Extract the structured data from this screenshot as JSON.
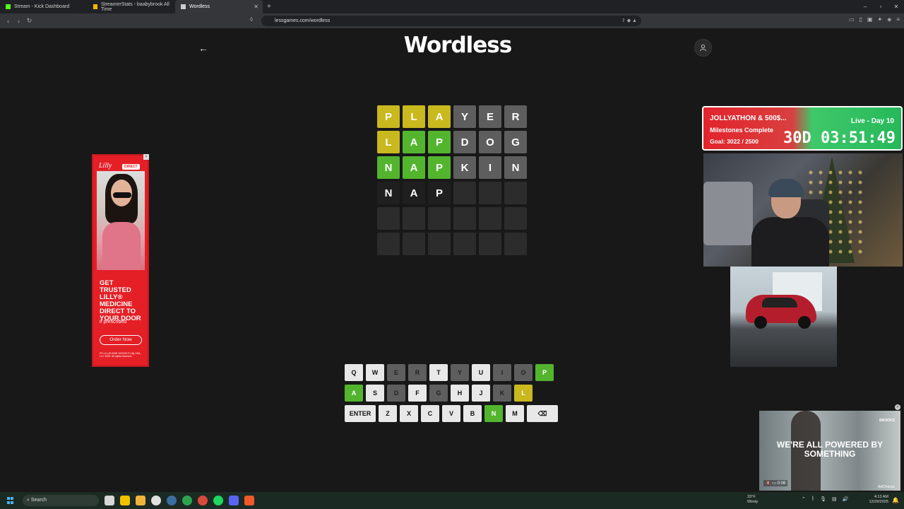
{
  "browser": {
    "tabs": [
      {
        "label": "Stream - Kick Dashboard",
        "favicon_color": "#53fc18"
      },
      {
        "label": "StreamerStats - baabybrook All Time",
        "favicon_color": "#f5b800"
      },
      {
        "label": "Wordless",
        "favicon_color": "#cccccc"
      }
    ],
    "url": "lessgames.com/wordless"
  },
  "page": {
    "title": "Wordless"
  },
  "grid": {
    "rows": [
      [
        {
          "l": "P",
          "s": "y"
        },
        {
          "l": "L",
          "s": "y"
        },
        {
          "l": "A",
          "s": "y"
        },
        {
          "l": "Y",
          "s": "x"
        },
        {
          "l": "E",
          "s": "x"
        },
        {
          "l": "R",
          "s": "x"
        }
      ],
      [
        {
          "l": "L",
          "s": "y"
        },
        {
          "l": "A",
          "s": "g"
        },
        {
          "l": "P",
          "s": "g"
        },
        {
          "l": "D",
          "s": "x"
        },
        {
          "l": "O",
          "s": "x"
        },
        {
          "l": "G",
          "s": "x"
        }
      ],
      [
        {
          "l": "N",
          "s": "g"
        },
        {
          "l": "A",
          "s": "g"
        },
        {
          "l": "P",
          "s": "g"
        },
        {
          "l": "K",
          "s": "x"
        },
        {
          "l": "I",
          "s": "x"
        },
        {
          "l": "N",
          "s": "x"
        }
      ],
      [
        {
          "l": "N",
          "s": "t"
        },
        {
          "l": "A",
          "s": "t"
        },
        {
          "l": "P",
          "s": "t"
        },
        {
          "l": "",
          "s": "e"
        },
        {
          "l": "",
          "s": "e"
        },
        {
          "l": "",
          "s": "e"
        }
      ],
      [
        {
          "l": "",
          "s": "e"
        },
        {
          "l": "",
          "s": "e"
        },
        {
          "l": "",
          "s": "e"
        },
        {
          "l": "",
          "s": "e"
        },
        {
          "l": "",
          "s": "e"
        },
        {
          "l": "",
          "s": "e"
        }
      ],
      [
        {
          "l": "",
          "s": "e"
        },
        {
          "l": "",
          "s": "e"
        },
        {
          "l": "",
          "s": "e"
        },
        {
          "l": "",
          "s": "e"
        },
        {
          "l": "",
          "s": "e"
        },
        {
          "l": "",
          "s": "e"
        }
      ]
    ]
  },
  "keyboard": {
    "rows": [
      [
        {
          "k": "Q",
          "s": ""
        },
        {
          "k": "W",
          "s": ""
        },
        {
          "k": "E",
          "s": "x"
        },
        {
          "k": "R",
          "s": "x"
        },
        {
          "k": "T",
          "s": ""
        },
        {
          "k": "Y",
          "s": "x"
        },
        {
          "k": "U",
          "s": ""
        },
        {
          "k": "I",
          "s": "x"
        },
        {
          "k": "O",
          "s": "x"
        },
        {
          "k": "P",
          "s": "g"
        }
      ],
      [
        {
          "k": "A",
          "s": "g"
        },
        {
          "k": "S",
          "s": ""
        },
        {
          "k": "D",
          "s": "x"
        },
        {
          "k": "F",
          "s": ""
        },
        {
          "k": "G",
          "s": "x"
        },
        {
          "k": "H",
          "s": ""
        },
        {
          "k": "J",
          "s": ""
        },
        {
          "k": "K",
          "s": "x"
        },
        {
          "k": "L",
          "s": "y"
        }
      ],
      [
        {
          "k": "ENTER",
          "s": "wide"
        },
        {
          "k": "Z",
          "s": ""
        },
        {
          "k": "X",
          "s": ""
        },
        {
          "k": "C",
          "s": ""
        },
        {
          "k": "V",
          "s": ""
        },
        {
          "k": "B",
          "s": ""
        },
        {
          "k": "N",
          "s": "g"
        },
        {
          "k": "M",
          "s": ""
        },
        {
          "k": "⌫",
          "s": "del"
        }
      ]
    ]
  },
  "ad_left": {
    "brand": "Lilly",
    "badge": "DIRECT",
    "headline": "GET TRUSTED LILLY® MEDICINE DIRECT TO YOUR DOOR",
    "subline": "if prescribed",
    "cta": "Order Now",
    "fine_print": "PP-LX-US-0098 10/2025 © Lilly USA, LLC 2025. All rights reserved."
  },
  "overlay": {
    "title": "JOLLYATHON & 500$...",
    "milestones": "Milestones Complete",
    "goal": "Goal: 3022 / 2500",
    "live": "Live - Day 10",
    "timer": "30D 03:51:49"
  },
  "ad_video": {
    "text": "WE'RE ALL POWERED BY SOMETHING",
    "brand": "BROOKS",
    "time": "0:08",
    "choices": "AdChoices"
  },
  "taskbar": {
    "search": "Search",
    "weather_temp": "33°F",
    "weather_desc": "Windy",
    "time": "4:13 AM",
    "date": "12/29/2025"
  }
}
